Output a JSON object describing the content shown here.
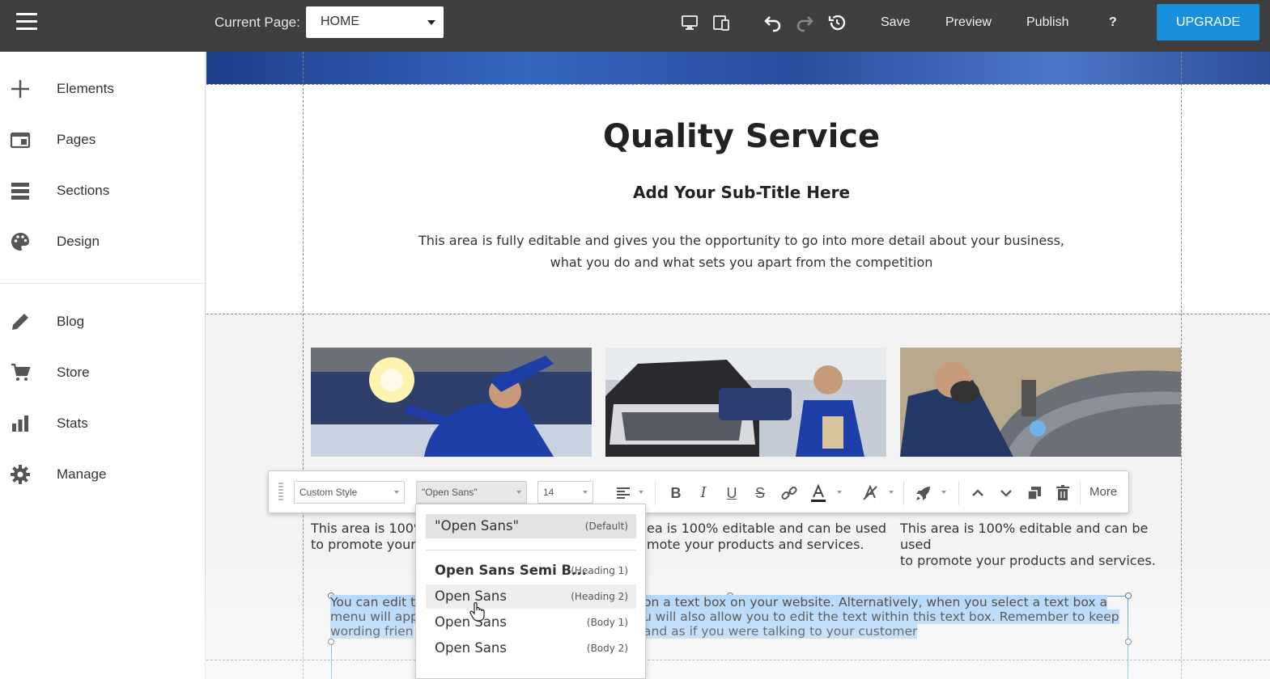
{
  "topbar": {
    "current_page_label": "Current Page:",
    "current_page_value": "HOME",
    "save": "Save",
    "preview": "Preview",
    "publish": "Publish",
    "help": "?",
    "upgrade": "UPGRADE"
  },
  "sidebar": {
    "items": [
      {
        "label": "Elements",
        "icon": "plus-icon"
      },
      {
        "label": "Pages",
        "icon": "pages-icon"
      },
      {
        "label": "Sections",
        "icon": "sections-icon"
      },
      {
        "label": "Design",
        "icon": "palette-icon"
      },
      {
        "label": "Blog",
        "icon": "pencil-icon"
      },
      {
        "label": "Store",
        "icon": "cart-icon"
      },
      {
        "label": "Stats",
        "icon": "stats-icon"
      },
      {
        "label": "Manage",
        "icon": "gear-icon"
      }
    ]
  },
  "content": {
    "title": "Quality Service",
    "subtitle": "Add Your Sub-Title Here",
    "body_line1": "This area is fully editable and gives you the opportunity to go into more detail about your business,",
    "body_line2": "what you do and what sets you apart from the competition",
    "col1_text_a": "This area is 100%",
    "col1_text_b": "to promote your",
    "col2_text_a": "ea is 100% editable and can be used",
    "col2_text_b": "mote your products and services.",
    "col3_text_a": "This area is 100% editable and can be used",
    "col3_text_b": "to promote your products and services.",
    "sel_line1_a": "You can edit t",
    "sel_line1_b": "on a text box on your website. Alternatively, when you select a text box a settings",
    "sel_line2_a": "menu will app",
    "sel_line2_b": "u will also allow you to edit the text within this text box. Remember to keep your",
    "sel_line3_a": "wording frien",
    "sel_line3_b": "and as if you were talking to your customer"
  },
  "toolbar": {
    "style_select": "Custom Style",
    "font_select": "\"Open Sans\"",
    "size_select": "14",
    "more": "More"
  },
  "font_dropdown": {
    "items": [
      {
        "name": "\"Open Sans\"",
        "role": "(Default)"
      },
      {
        "name": "Open Sans Semi B...",
        "role": "(Heading 1)"
      },
      {
        "name": "Open Sans",
        "role": "(Heading 2)"
      },
      {
        "name": "Open Sans",
        "role": "(Body 1)"
      },
      {
        "name": "Open Sans",
        "role": "(Body 2)"
      }
    ]
  }
}
